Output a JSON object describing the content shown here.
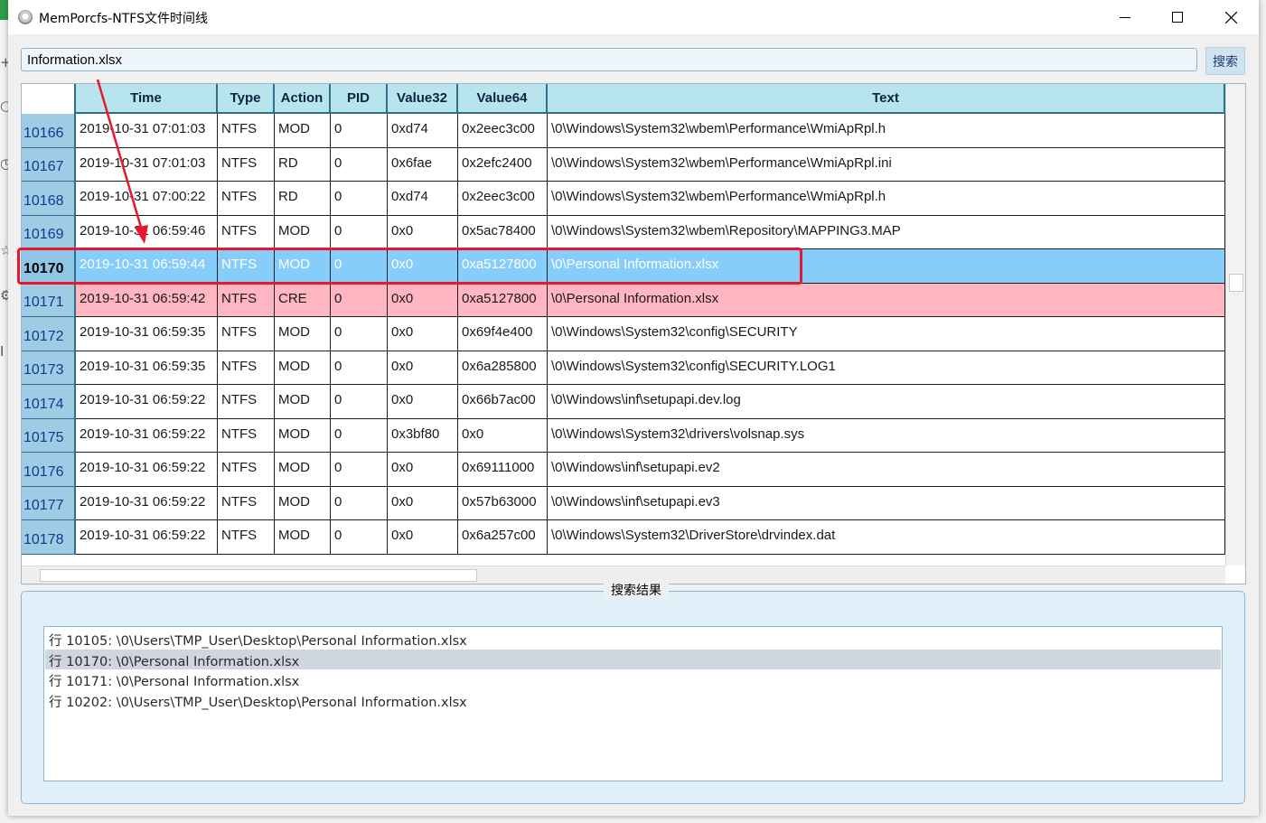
{
  "window": {
    "title": "MemPorcfs-NTFS文件时间线",
    "controls": {
      "minimize": "minimize-icon",
      "maximize": "maximize-icon",
      "close": "close-icon"
    }
  },
  "search": {
    "value": "Information.xlsx",
    "button_label": "搜索"
  },
  "table": {
    "columns": [
      "Time",
      "Type",
      "Action",
      "PID",
      "Value32",
      "Value64",
      "Text"
    ],
    "rows": [
      {
        "id": "10166",
        "time": "2019-10-31 07:01:03",
        "type": "NTFS",
        "action": "MOD",
        "pid": "0",
        "v32": "0xd74",
        "v64": "0x2eec3c00",
        "text": "\\0\\Windows\\System32\\wbem\\Performance\\WmiApRpl.h",
        "state": ""
      },
      {
        "id": "10167",
        "time": "2019-10-31 07:01:03",
        "type": "NTFS",
        "action": "RD",
        "pid": "0",
        "v32": "0x6fae",
        "v64": "0x2efc2400",
        "text": "\\0\\Windows\\System32\\wbem\\Performance\\WmiApRpl.ini",
        "state": ""
      },
      {
        "id": "10168",
        "time": "2019-10-31 07:00:22",
        "type": "NTFS",
        "action": "RD",
        "pid": "0",
        "v32": "0xd74",
        "v64": "0x2eec3c00",
        "text": "\\0\\Windows\\System32\\wbem\\Performance\\WmiApRpl.h",
        "state": ""
      },
      {
        "id": "10169",
        "time": "2019-10-31 06:59:46",
        "type": "NTFS",
        "action": "MOD",
        "pid": "0",
        "v32": "0x0",
        "v64": "0x5ac78400",
        "text": "\\0\\Windows\\System32\\wbem\\Repository\\MAPPING3.MAP",
        "state": ""
      },
      {
        "id": "10170",
        "time": "2019-10-31 06:59:44",
        "type": "NTFS",
        "action": "MOD",
        "pid": "0",
        "v32": "0x0",
        "v64": "0xa5127800",
        "text": "\\0\\Personal Information.xlsx",
        "state": "selected"
      },
      {
        "id": "10171",
        "time": "2019-10-31 06:59:42",
        "type": "NTFS",
        "action": "CRE",
        "pid": "0",
        "v32": "0x0",
        "v64": "0xa5127800",
        "text": "\\0\\Personal Information.xlsx",
        "state": "created"
      },
      {
        "id": "10172",
        "time": "2019-10-31 06:59:35",
        "type": "NTFS",
        "action": "MOD",
        "pid": "0",
        "v32": "0x0",
        "v64": "0x69f4e400",
        "text": "\\0\\Windows\\System32\\config\\SECURITY",
        "state": ""
      },
      {
        "id": "10173",
        "time": "2019-10-31 06:59:35",
        "type": "NTFS",
        "action": "MOD",
        "pid": "0",
        "v32": "0x0",
        "v64": "0x6a285800",
        "text": "\\0\\Windows\\System32\\config\\SECURITY.LOG1",
        "state": ""
      },
      {
        "id": "10174",
        "time": "2019-10-31 06:59:22",
        "type": "NTFS",
        "action": "MOD",
        "pid": "0",
        "v32": "0x0",
        "v64": "0x66b7ac00",
        "text": "\\0\\Windows\\inf\\setupapi.dev.log",
        "state": ""
      },
      {
        "id": "10175",
        "time": "2019-10-31 06:59:22",
        "type": "NTFS",
        "action": "MOD",
        "pid": "0",
        "v32": "0x3bf80",
        "v64": "0x0",
        "text": "\\0\\Windows\\System32\\drivers\\volsnap.sys",
        "state": ""
      },
      {
        "id": "10176",
        "time": "2019-10-31 06:59:22",
        "type": "NTFS",
        "action": "MOD",
        "pid": "0",
        "v32": "0x0",
        "v64": "0x69111000",
        "text": "\\0\\Windows\\inf\\setupapi.ev2",
        "state": ""
      },
      {
        "id": "10177",
        "time": "2019-10-31 06:59:22",
        "type": "NTFS",
        "action": "MOD",
        "pid": "0",
        "v32": "0x0",
        "v64": "0x57b63000",
        "text": "\\0\\Windows\\inf\\setupapi.ev3",
        "state": ""
      },
      {
        "id": "10178",
        "time": "2019-10-31 06:59:22",
        "type": "NTFS",
        "action": "MOD",
        "pid": "0",
        "v32": "0x0",
        "v64": "0x6a257c00",
        "text": "\\0\\Windows\\System32\\DriverStore\\drvindex.dat",
        "state": ""
      }
    ],
    "colors": {
      "selected_row": "#87cdfa",
      "created_row": "#ffb6c1",
      "header": "#b8e4ee"
    }
  },
  "results": {
    "title": "搜索结果",
    "items": [
      {
        "text": "行 10105: \\0\\Users\\TMP_User\\Desktop\\Personal Information.xlsx",
        "selected": false
      },
      {
        "text": "行 10170: \\0\\Personal Information.xlsx",
        "selected": true
      },
      {
        "text": "行 10171: \\0\\Personal Information.xlsx",
        "selected": false
      },
      {
        "text": "行 10202: \\0\\Users\\TMP_User\\Desktop\\Personal Information.xlsx",
        "selected": false
      }
    ]
  },
  "annotation": {
    "color": "#e8182c"
  }
}
